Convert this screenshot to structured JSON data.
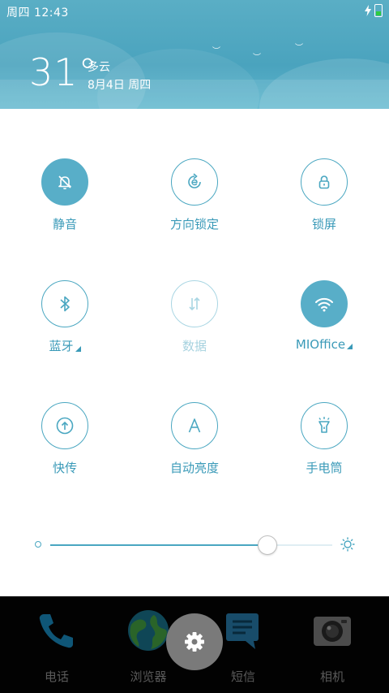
{
  "status_bar": {
    "time": "周四 12:43"
  },
  "weather": {
    "temperature": "31°",
    "condition": "多云",
    "date": "8月4日 周四"
  },
  "toggles": [
    {
      "label": "静音",
      "icon": "bell-off-icon",
      "state": "on"
    },
    {
      "label": "方向锁定",
      "icon": "rotation-lock-icon",
      "state": "off"
    },
    {
      "label": "锁屏",
      "icon": "lock-icon",
      "state": "off"
    },
    {
      "label": "蓝牙",
      "icon": "bluetooth-icon",
      "state": "off",
      "has_menu": true
    },
    {
      "label": "数据",
      "icon": "mobile-data-icon",
      "state": "disabled"
    },
    {
      "label": "MIOffice",
      "icon": "wifi-icon",
      "state": "on",
      "has_menu": true
    },
    {
      "label": "快传",
      "icon": "quick-transfer-icon",
      "state": "off"
    },
    {
      "label": "自动亮度",
      "icon": "auto-brightness-icon",
      "state": "off"
    },
    {
      "label": "手电筒",
      "icon": "flashlight-icon",
      "state": "off"
    }
  ],
  "brightness": {
    "level": 0.77
  },
  "dock": [
    {
      "label": "电话",
      "icon": "phone-icon"
    },
    {
      "label": "浏览器",
      "icon": "browser-icon"
    },
    {
      "label": "短信",
      "icon": "messages-icon"
    },
    {
      "label": "相机",
      "icon": "camera-icon"
    }
  ],
  "colors": {
    "accent": "#4aa7c1",
    "accent_on": "#58aec8",
    "header": "#4aa3be",
    "dock_bg": "#020202"
  }
}
